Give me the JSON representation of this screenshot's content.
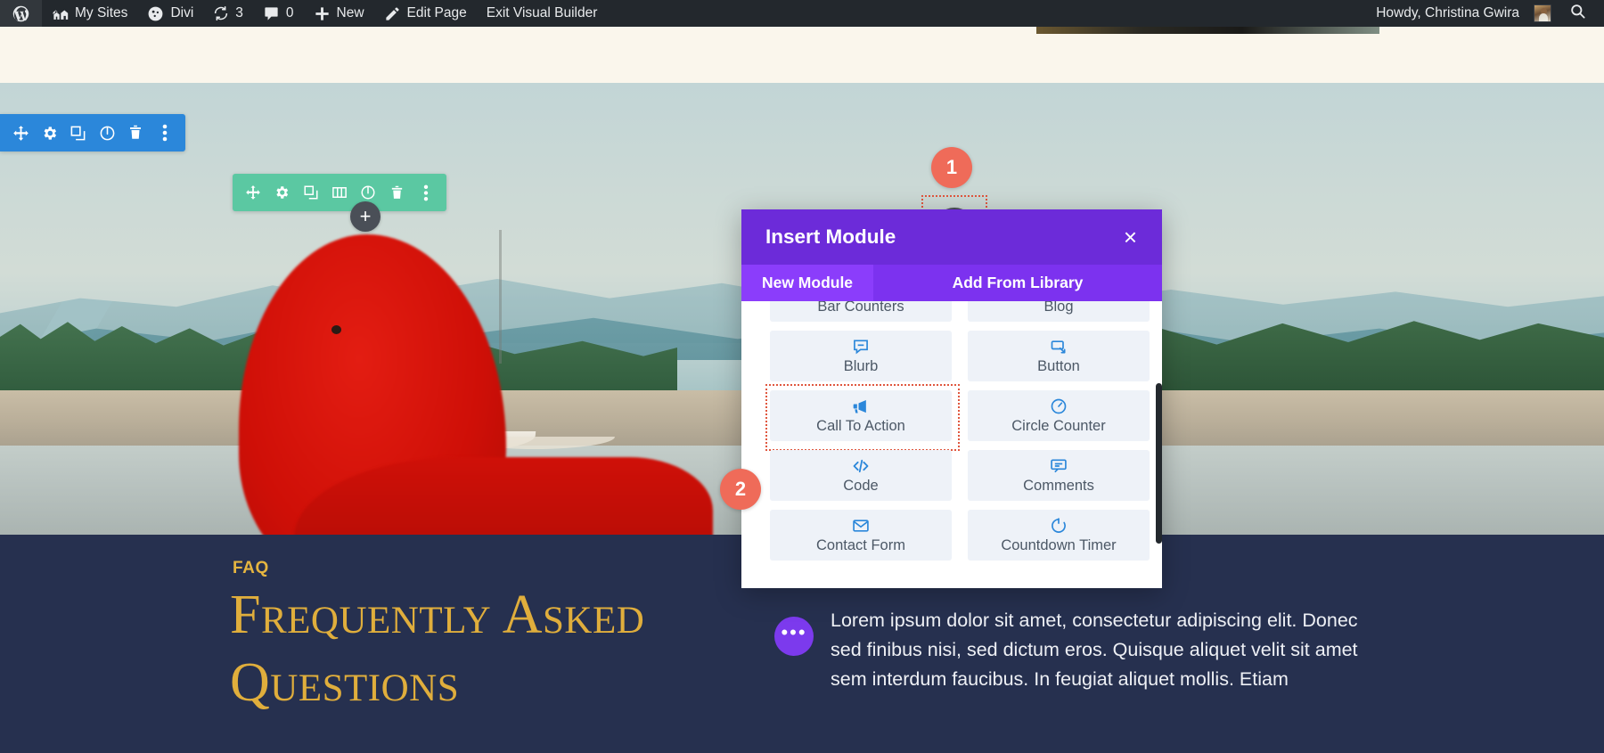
{
  "admin_bar": {
    "items": [
      {
        "label": "",
        "icon": "wordpress-logo-icon"
      },
      {
        "label": "My Sites",
        "icon": "multisite-icon"
      },
      {
        "label": "Divi",
        "icon": "divi-icon"
      },
      {
        "label": "3",
        "icon": "updates-icon"
      },
      {
        "label": "0",
        "icon": "comments-icon"
      },
      {
        "label": "New",
        "icon": "plus-icon"
      },
      {
        "label": "Edit Page",
        "icon": "pencil-icon"
      },
      {
        "label": "Exit Visual Builder",
        "icon": ""
      }
    ],
    "howdy": "Howdy, Christina Gwira",
    "avatar_name": "avatar",
    "search_icon": "search-icon"
  },
  "section_toolbar": {
    "buttons": [
      "move-icon",
      "gear-icon",
      "duplicate-icon",
      "disable-icon",
      "trash-icon",
      "more-options-icon"
    ],
    "color": "#2b87da"
  },
  "row_toolbar": {
    "buttons": [
      "move-icon",
      "gear-icon",
      "duplicate-icon",
      "columns-icon",
      "disable-icon",
      "trash-icon",
      "more-options-icon"
    ],
    "color": "#5bc8a2"
  },
  "add_buttons": {
    "row_plus": "+",
    "module_plus": "+"
  },
  "steps": [
    {
      "number": "1"
    },
    {
      "number": "2"
    }
  ],
  "modal": {
    "title": "Insert Module",
    "close_label": "×",
    "tabs": [
      {
        "label": "New Module",
        "active": true
      },
      {
        "label": "Add From Library",
        "active": false
      }
    ],
    "modules": [
      {
        "label": "Bar Counters",
        "icon": "bar-counters-icon",
        "highlighted": false
      },
      {
        "label": "Blog",
        "icon": "blog-icon",
        "highlighted": false
      },
      {
        "label": "Blurb",
        "icon": "blurb-icon",
        "highlighted": false
      },
      {
        "label": "Button",
        "icon": "button-icon",
        "highlighted": false
      },
      {
        "label": "Call To Action",
        "icon": "call-to-action-icon",
        "highlighted": true
      },
      {
        "label": "Circle Counter",
        "icon": "circle-counter-icon",
        "highlighted": false
      },
      {
        "label": "Code",
        "icon": "code-icon",
        "highlighted": false
      },
      {
        "label": "Comments",
        "icon": "comments-module-icon",
        "highlighted": false
      },
      {
        "label": "Contact Form",
        "icon": "contact-form-icon",
        "highlighted": false
      },
      {
        "label": "Countdown Timer",
        "icon": "countdown-timer-icon",
        "highlighted": false
      }
    ],
    "accent": "#6c2bd9"
  },
  "faq": {
    "eyebrow": "FAQ",
    "title": "Frequently Asked Questions",
    "paragraph": "Lorem ipsum dolor sit amet, consectetur adipiscing elit. Donec sed finibus nisi, sed dictum eros. Quisque aliquet velit sit amet sem interdum faucibus. In feugiat aliquet mollis. Etiam",
    "bullet_icon": "•••",
    "title_color": "#e0ae3c",
    "bg_color": "#26304f"
  }
}
